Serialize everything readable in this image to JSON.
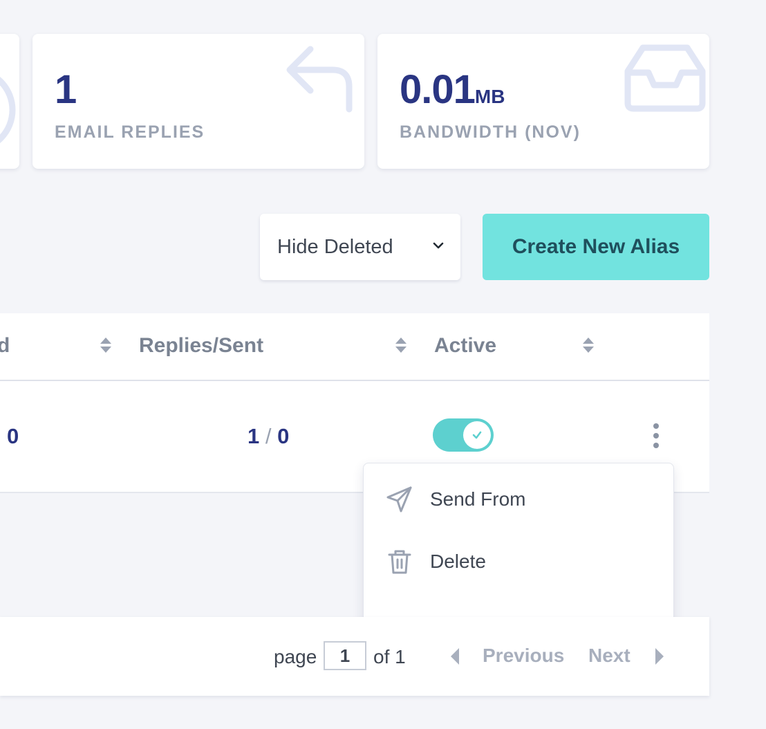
{
  "stats": [
    {
      "value": "1",
      "unit": "",
      "label": "EMAIL REPLIES",
      "icon": "reply-arrow-icon"
    },
    {
      "value": "0.01",
      "unit": "MB",
      "label": "BANDWIDTH (NOV)",
      "icon": "inbox-tray-icon"
    }
  ],
  "toolbar": {
    "filter_selected": "Hide Deleted",
    "create_button_label": "Create New Alias"
  },
  "table": {
    "columns": [
      {
        "label": "d",
        "sortable": true
      },
      {
        "label": "Replies/Sent",
        "sortable": true
      },
      {
        "label": "Active",
        "sortable": true
      }
    ],
    "rows": [
      {
        "blocked": "0",
        "replies": "1",
        "separator": "/",
        "sent": "0",
        "active": true
      }
    ]
  },
  "row_menu": {
    "items": [
      {
        "label": "Send From",
        "icon": "send-paper-plane-icon"
      },
      {
        "label": "Delete",
        "icon": "trash-icon"
      }
    ]
  },
  "pagination": {
    "page_label": "page",
    "current_page": "1",
    "of_label": "of 1",
    "previous_label": "Previous",
    "next_label": "Next"
  },
  "colors": {
    "background": "#f4f5f9",
    "accent": "#72e3df",
    "toggle_on": "#5dd0cf",
    "value_text": "#2a3582",
    "muted_text": "#9aa2b1"
  }
}
